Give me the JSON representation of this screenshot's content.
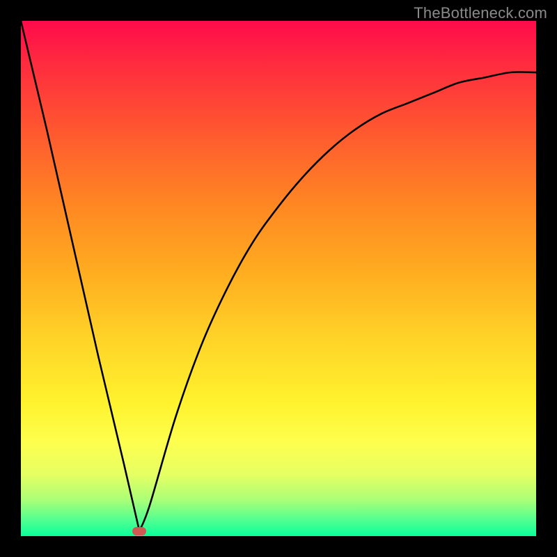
{
  "watermark": "TheBottleneck.com",
  "chart_data": {
    "type": "line",
    "title": "",
    "xlabel": "",
    "ylabel": "",
    "xlim": [
      0,
      100
    ],
    "ylim": [
      0,
      100
    ],
    "x": [
      0,
      5,
      10,
      15,
      20,
      23,
      25,
      30,
      35,
      40,
      45,
      50,
      55,
      60,
      65,
      70,
      75,
      80,
      85,
      90,
      95,
      100
    ],
    "values": [
      100,
      79,
      57,
      35,
      14,
      1,
      6,
      23,
      37,
      48,
      57,
      64,
      70,
      75,
      79,
      82,
      84,
      86,
      88,
      89,
      90,
      90
    ],
    "marker": {
      "x": 23,
      "y": 1
    },
    "annotations": [
      "TheBottleneck.com"
    ]
  },
  "colors": {
    "curve": "#000000",
    "marker": "#cf5a53",
    "frame": "#000000"
  }
}
